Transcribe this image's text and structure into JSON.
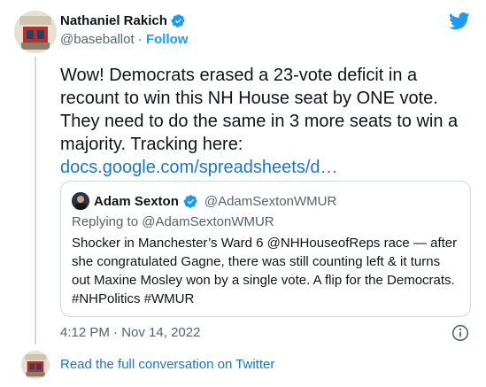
{
  "author": {
    "name": "Nathaniel Rakich",
    "handle": "@baseballot",
    "separator": "·",
    "follow_label": "Follow"
  },
  "tweet": {
    "text": "Wow! Democrats erased a 23-vote deficit in a recount to win this NH House seat by ONE vote. They need to do the same in 3 more seats to win a majority. Tracking here:",
    "link": "docs.google.com/spreadsheets/d…",
    "time": "4:12 PM",
    "separator": "·",
    "date": "Nov 14, 2022"
  },
  "quote": {
    "name": "Adam Sexton",
    "handle": "@AdamSextonWMUR",
    "replying": "Replying to @AdamSextonWMUR",
    "text": "Shocker in Manchester’s Ward 6 @NHHouseofReps race — after she congratulated Gagne, there was still counting left & it turns out Maxine Mosley won by a single vote. A flip for the Democrats. #NHPolitics #WMUR"
  },
  "footer": {
    "read_label": "Read the full conversation on Twitter"
  },
  "icons": {
    "verified": "verified-badge-icon",
    "brand": "twitter-bird-icon",
    "info": "info-icon"
  },
  "colors": {
    "accent": "#1d9bf0",
    "link": "#1b75d0",
    "secondary_text": "#536471",
    "border": "#cfd9de"
  }
}
